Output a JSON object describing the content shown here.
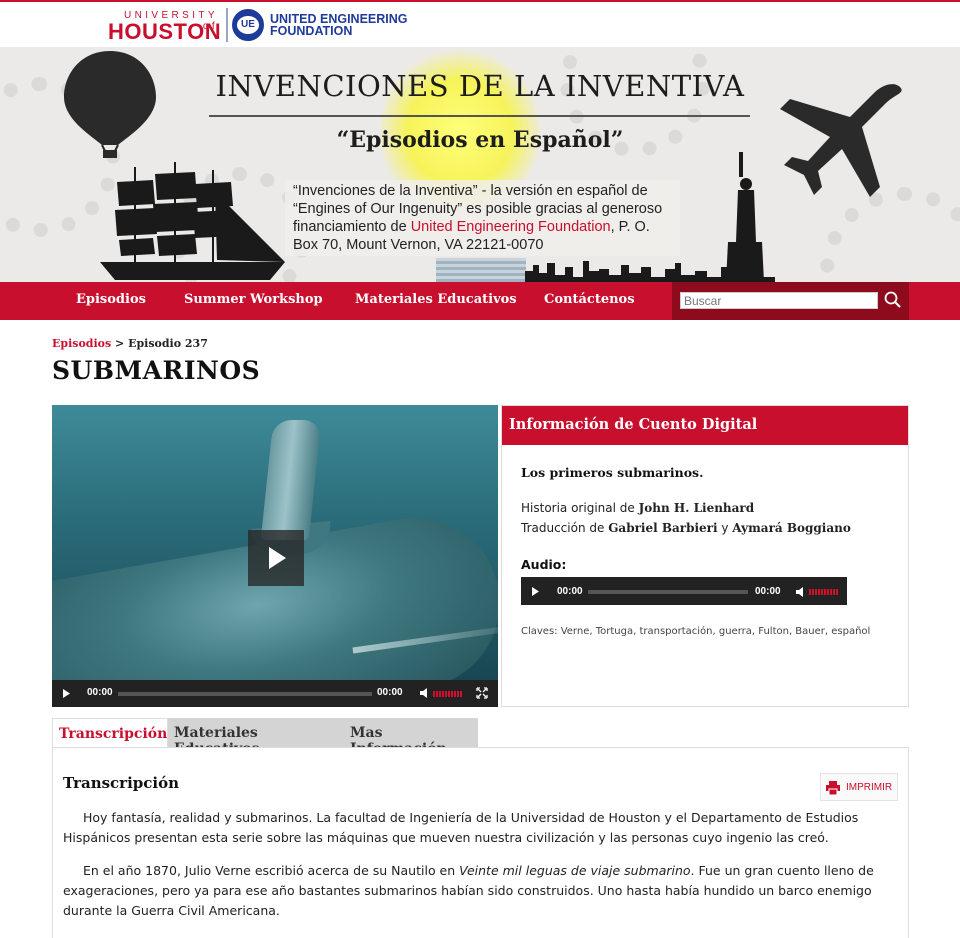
{
  "logos": {
    "uh_small": "UNIVERSITY of",
    "uh_big": "HOUSTON",
    "uef_line1": "UNITED ENGINEERING",
    "uef_line2": "FOUNDATION"
  },
  "banner": {
    "title": "INVENCIONES DE LA INVENTIVA",
    "subtitle": "“Episodios en Español”",
    "desc_part1": "“Invenciones de la Inventiva” - la versión en español de “Engines of Our Ingenuity” es posible gracias al generoso financiamiento de ",
    "desc_link": "United Engineering Foundation",
    "desc_part2": ", P. O. Box 70, Mount Vernon, VA 22121-0070"
  },
  "nav": {
    "items": [
      "Episodios",
      "Summer Workshop",
      "Materiales Educativos",
      "Contáctenos"
    ],
    "search_placeholder": "Buscar"
  },
  "breadcrumb": {
    "link": "Episodios",
    "separator": " > ",
    "current": "Episodio 237"
  },
  "page_title": "SUBMARINOS",
  "video": {
    "time_current": "00:00",
    "time_total": "00:00"
  },
  "info": {
    "header": "Información de Cuento Digital",
    "subtitle": "Los primeros submarinos.",
    "story_label": "Historia original de ",
    "story_author": "John H. Lienhard",
    "translation_label": "Traducción de ",
    "translator1": "Gabriel Barbieri",
    "and": " y ",
    "translator2": "Aymará Boggiano",
    "audio_label": "Audio:",
    "audio_current": "00:00",
    "audio_total": "00:00",
    "tags": "Claves: Verne, Tortuga, transportación, guerra, Fulton, Bauer, español"
  },
  "tabs": [
    "Transcripción",
    "Materiales Educativos",
    "Mas Información"
  ],
  "transcript": {
    "title": "Transcripción",
    "print_label": "IMPRIMIR",
    "para1": "Hoy fantasía, realidad y submarinos. La facultad de Ingeniería de la Universidad de Houston y el Departamento de Estudios Hispánicos presentan esta serie sobre las máquinas que mueven nuestra civilización y las personas cuyo ingenio las creó.",
    "para2_a": "En el año 1870, Julio Verne escribió acerca de su Nautilo en ",
    "para2_italic": "Veinte mil leguas de viaje submarino",
    "para2_b": ". Fue un gran cuento lleno de exageraciones, pero ya para ese año bastantes submarinos habían sido construidos. Uno hasta había hundido un barco enemigo durante la Guerra Civil Americana."
  },
  "colors": {
    "brand_red": "#c8102e",
    "brand_blue": "#1f3b9a",
    "player_bar": "#222222"
  }
}
